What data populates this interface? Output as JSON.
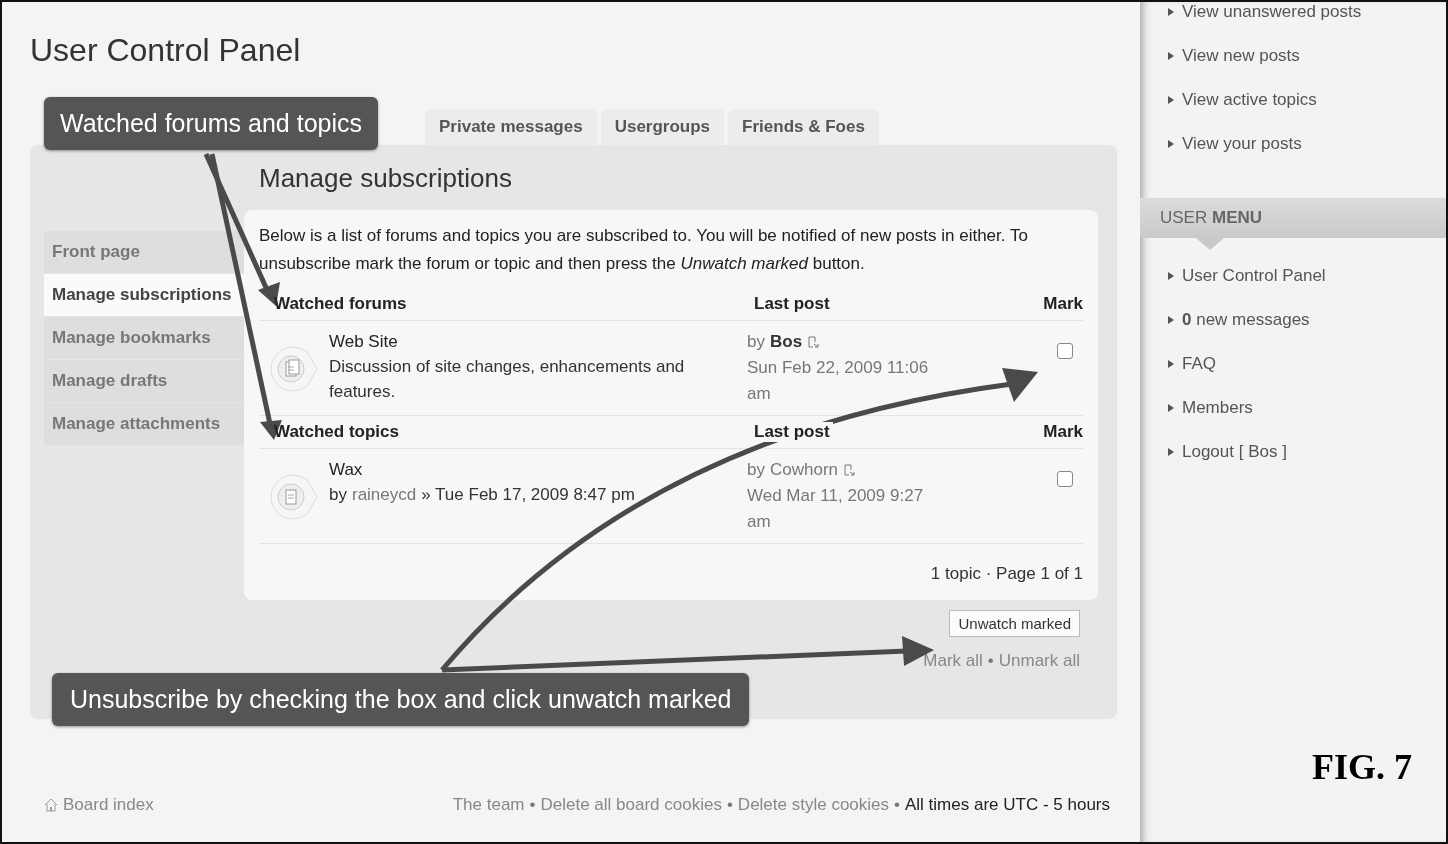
{
  "page_title": "User Control Panel",
  "tabs": [
    {
      "label": "Private messages",
      "selected": false
    },
    {
      "label": "Usergroups",
      "selected": false
    },
    {
      "label": "Friends & Foes",
      "selected": false
    }
  ],
  "nav": [
    {
      "label": "Front page",
      "selected": false
    },
    {
      "label": "Manage subscriptions",
      "selected": true
    },
    {
      "label": "Manage bookmarks",
      "selected": false
    },
    {
      "label": "Manage drafts",
      "selected": false
    },
    {
      "label": "Manage attachments",
      "selected": false
    }
  ],
  "heading": "Manage subscriptions",
  "intro": "Below is a list of forums and topics you are subscribed to. You will be notified of new posts in either. To unsubscribe mark the forum or topic and then press the *Unwatch marked* button.",
  "sections": [
    {
      "columns": [
        "Watched forums",
        "Last post",
        "Mark"
      ],
      "rows": [
        {
          "title": "Web Site",
          "kind": "forum",
          "description": "Discussion of site changes, enhancements and features.",
          "last_by": "by",
          "last_author": "Bos",
          "author_bold": true,
          "last_date": "Sun Feb 22, 2009 11:06 am",
          "checked": false
        }
      ]
    },
    {
      "columns": [
        "Watched topics",
        "Last post",
        "Mark"
      ],
      "rows": [
        {
          "title": "Wax",
          "kind": "topic",
          "by": "by",
          "author": "raineycd",
          "date": "» Tue Feb 17, 2009 8:47 pm",
          "last_by": "by",
          "last_author": "Cowhorn",
          "author_bold": false,
          "last_date": "Wed Mar 11, 2009 9:27 am",
          "checked": false
        }
      ]
    }
  ],
  "pagination": "1 topic · Page 1 of 1",
  "unwatch_button": "Unwatch marked",
  "mark_links": [
    "Mark all",
    "•",
    "Unmark all"
  ],
  "callouts": [
    "Watched forums and topics",
    "Unsubscribe by checking the box and click unwatch marked"
  ],
  "footer": {
    "board_index": "Board index",
    "links": [
      "The team",
      "•",
      "Delete all board cookies",
      "•",
      "Delete style cookies",
      "•"
    ],
    "timezone": "All times are UTC - 5 hours"
  },
  "quick_links": [
    "View unanswered posts",
    "View new posts",
    "View active topics",
    "View your posts"
  ],
  "user_menu": {
    "title": "USER **MENU**",
    "items": [
      "User Control Panel",
      "**0** new messages",
      "FAQ",
      "Members",
      "Logout [ Bos ]"
    ]
  },
  "figure_label": "FIG. 7"
}
